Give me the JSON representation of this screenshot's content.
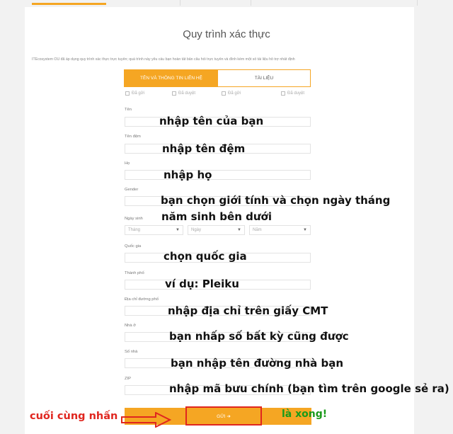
{
  "header": {
    "title": "Quy trình xác thực"
  },
  "intro_text": "ITEcosystem OÜ đã áp dụng quy trình xác thực trực tuyến; quá trình này yêu cầu bạn hoàn tất bản câu hỏi trực tuyến và đính kèm một số tài liệu hỗ trợ nhất định",
  "tabs": [
    {
      "label": "TÊN VÀ THÔNG TIN LIÊN HỆ",
      "active": true
    },
    {
      "label": "TÀI LIỆU",
      "active": false
    }
  ],
  "status": [
    "Đã gửi",
    "Đã duyệt",
    "Đã gửi",
    "Đã duyệt"
  ],
  "form": {
    "first_name_label": "Tên",
    "middle_name_label": "Tên đệm",
    "last_name_label": "Họ",
    "gender_label": "Gender",
    "dob_label": "Ngày sinh",
    "dob_month_placeholder": "Tháng",
    "dob_day_placeholder": "Ngày",
    "dob_year_placeholder": "Năm",
    "country_label": "Quốc gia",
    "city_label": "Thành phố",
    "address_label": "Địa chỉ đường phố",
    "house_label": "Nhà ở",
    "house_number_label": "Số nhà",
    "zip_label": "ZIP",
    "submit_label": "GỬI ➔"
  },
  "annotations": {
    "first_name": "nhập tên của bạn",
    "middle_name": "nhập tên đệm",
    "last_name": "nhập họ",
    "gender_line1": "bạn chọn giới tính và chọn ngày tháng",
    "gender_line2": "năm sinh bên dưới",
    "country": "chọn quốc gia",
    "city": "ví dụ: Pleiku",
    "address": "nhập địa chỉ trên giấy CMT",
    "house": "bạn nhấp số bất kỳ  cũng được",
    "house_number": "bạn nhập tên đường nhà bạn",
    "zip": "nhập mã bưu chính (bạn tìm trên google sẻ ra)",
    "final_left": "cuối cùng nhấn",
    "final_right": "là xong!"
  },
  "colors": {
    "accent": "#f5a623",
    "highlight": "#e0261f",
    "success": "#1a9a1a"
  }
}
